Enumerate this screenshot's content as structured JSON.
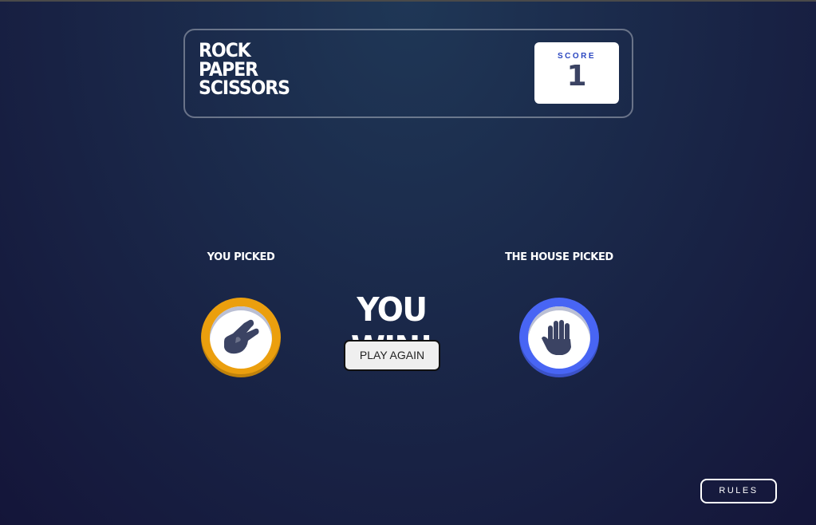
{
  "header": {
    "title_lines": [
      "ROCK",
      "PAPER",
      "SCISSORS"
    ],
    "score_label": "SCORE",
    "score_value": "1"
  },
  "game": {
    "player_label": "YOU PICKED",
    "house_label": "THE HOUSE PICKED",
    "player_choice": "scissors",
    "house_choice": "paper",
    "result": "YOU WIN!",
    "play_again_label": "PLAY AGAIN"
  },
  "footer": {
    "rules_label": "RULES"
  },
  "colors": {
    "background_top": "#1f3756",
    "background_bottom": "#141539",
    "scissors_ring": "#eb9f0e",
    "paper_ring": "#4865f4",
    "score_label": "#2a46c0",
    "score_value": "#3b4363",
    "hand_icon": "#3b4363"
  },
  "icons": {
    "player": "scissors-hand-icon",
    "house": "paper-hand-icon"
  }
}
